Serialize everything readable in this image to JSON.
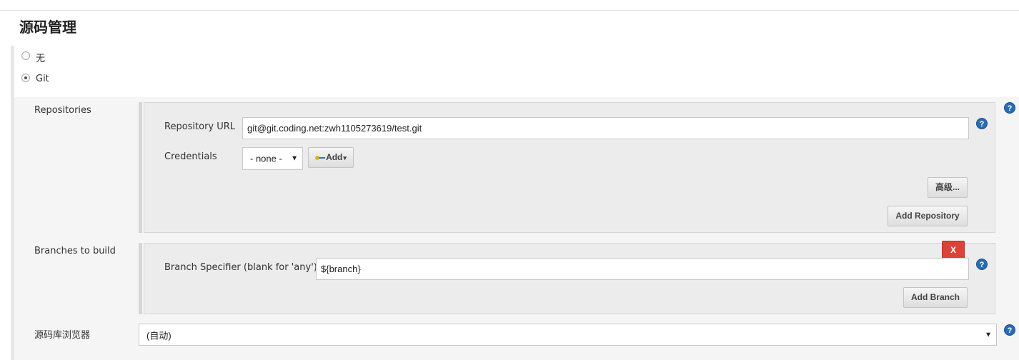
{
  "section": {
    "title": "源码管理"
  },
  "scm_options": [
    {
      "label": "无",
      "selected": false
    },
    {
      "label": "Git",
      "selected": true
    }
  ],
  "repositories": {
    "label": "Repositories",
    "url_label": "Repository URL",
    "url_value": "git@git.coding.net:zwh1105273619/test.git",
    "credentials_label": "Credentials",
    "credentials_value": "- none -",
    "add_label": "Add",
    "advanced_label": "高级...",
    "add_repository_label": "Add Repository"
  },
  "branches": {
    "label": "Branches to build",
    "delete_label": "X",
    "specifier_label": "Branch Specifier (blank for 'any')",
    "specifier_value": "${branch}",
    "add_branch_label": "Add Branch"
  },
  "browser": {
    "label": "源码库浏览器",
    "value": "(自动)"
  },
  "help": {
    "glyph": "?"
  },
  "icons": {
    "help": "help-icon",
    "key": "key-icon",
    "dropdown": "chevron-down-icon"
  },
  "colors": {
    "help": "#2a6cb3",
    "delete": "#d9433a"
  }
}
